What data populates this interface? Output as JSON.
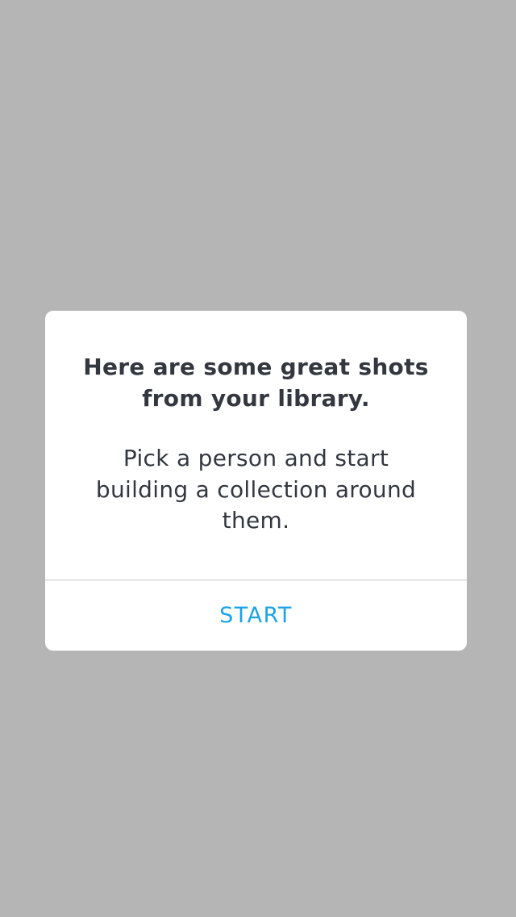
{
  "dialog": {
    "headline": "Here are some great shots from your library.",
    "message": "Pick a person and start building a collection around them.",
    "start_label": "START"
  },
  "colors": {
    "overlay": "#b5b5b5",
    "text": "#333740",
    "accent": "#1aa3e8",
    "divider": "#c8c8c8"
  }
}
